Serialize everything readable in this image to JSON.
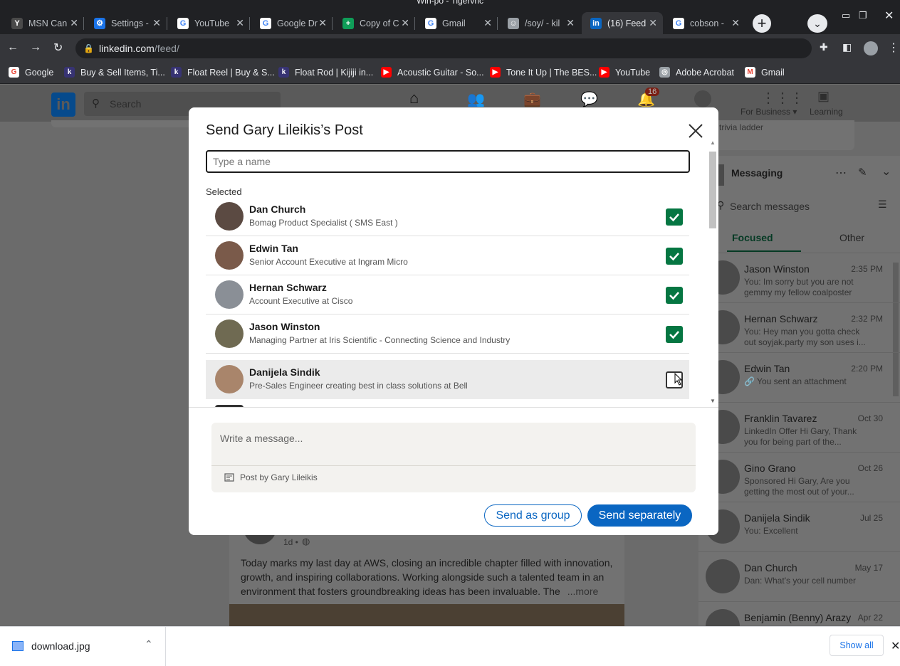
{
  "window": {
    "title": "Win-po - Tigervnc"
  },
  "tabs": [
    {
      "label": "MSN Can",
      "fav_color": "#4a4a4a",
      "fav_glyph": "Y"
    },
    {
      "label": "Settings -",
      "fav_color": "#1a73e8",
      "fav_glyph": "⚙"
    },
    {
      "label": "YouTube",
      "fav_color": "#ffffff",
      "fav_glyph": "G"
    },
    {
      "label": "Google Dr",
      "fav_color": "#ffffff",
      "fav_glyph": "G"
    },
    {
      "label": "Copy of C",
      "fav_color": "#0f9d58",
      "fav_glyph": "+"
    },
    {
      "label": "Gmail",
      "fav_color": "#ffffff",
      "fav_glyph": "G"
    },
    {
      "label": "/soy/ - kil",
      "fav_color": "#9aa0a6",
      "fav_glyph": "☺"
    },
    {
      "label": "(16) Feed",
      "fav_color": "#0a66c2",
      "fav_glyph": "in"
    },
    {
      "label": "cobson -",
      "fav_color": "#ffffff",
      "fav_glyph": "G"
    }
  ],
  "address": {
    "domain": "linkedin.com",
    "path": "/feed/"
  },
  "bookmarks": [
    {
      "label": "Google",
      "color": "#ffffff",
      "glyph": "G"
    },
    {
      "label": "Buy & Sell Items, Ti...",
      "color": "#373373",
      "glyph": "k"
    },
    {
      "label": "Float Reel | Buy & S...",
      "color": "#373373",
      "glyph": "k"
    },
    {
      "label": "Float Rod | Kijiji in...",
      "color": "#373373",
      "glyph": "k"
    },
    {
      "label": "Acoustic Guitar - So...",
      "color": "#ff0000",
      "glyph": "▶"
    },
    {
      "label": "Tone It Up | The BES...",
      "color": "#ff0000",
      "glyph": "▶"
    },
    {
      "label": "YouTube",
      "color": "#ff0000",
      "glyph": "▶"
    },
    {
      "label": "Adobe Acrobat",
      "color": "#9aa0a6",
      "glyph": "◎"
    },
    {
      "label": "Gmail",
      "color": "#ffffff",
      "glyph": "M"
    }
  ],
  "linkedin_nav": {
    "search_placeholder": "Search",
    "notif_count": "16",
    "for_business": "For Business ▾",
    "learning": "Learning",
    "trivia": "trivia ladder"
  },
  "modal": {
    "title": "Send Gary Lileikis’s Post",
    "name_placeholder": "Type a name",
    "selected_label": "Selected",
    "people": [
      {
        "name": "Dan Church",
        "title": "Bomag Product Specialist ( SMS East )",
        "checked": true,
        "avatar_color": "#5b4a42"
      },
      {
        "name": "Edwin Tan",
        "title": "Senior Account Executive at Ingram Micro",
        "checked": true,
        "avatar_color": "#7a5a4a"
      },
      {
        "name": "Hernan Schwarz",
        "title": "Account Executive at Cisco",
        "checked": true,
        "avatar_color": "#8a8f96"
      },
      {
        "name": "Jason Winston",
        "title": "Managing Partner at Iris Scientific - Connecting Science and Industry",
        "checked": true,
        "avatar_color": "#6f6a52"
      },
      {
        "name": "Danijela Sindik",
        "title": "Pre-Sales Engineer creating best in class solutions at Bell",
        "checked": false,
        "avatar_color": "#a9856b"
      }
    ],
    "message_placeholder": "Write a message...",
    "post_by": "Post by Gary Lileikis",
    "send_group": "Send as group",
    "send_separately": "Send separately"
  },
  "messaging": {
    "title": "Messaging",
    "search_placeholder": "Search messages",
    "tab_focused": "Focused",
    "tab_other": "Other",
    "threads": [
      {
        "name": "Jason Winston",
        "time": "2:35 PM",
        "preview": "You: Im sorry but you are not gemmy my fellow coalposter"
      },
      {
        "name": "Hernan Schwarz",
        "time": "2:32 PM",
        "preview": "You: Hey man you gotta check out soyjak.party my son uses i..."
      },
      {
        "name": "Edwin Tan",
        "time": "2:20 PM",
        "preview": "🔗 You sent an attachment"
      },
      {
        "name": "Franklin Tavarez",
        "time": "Oct 30",
        "preview": "LinkedIn Offer  Hi Gary, Thank you for being part of the..."
      },
      {
        "name": "Gino Grano",
        "time": "Oct 26",
        "preview": "Sponsored  Hi Gary, Are you getting the most out of your..."
      },
      {
        "name": "Danijela Sindik",
        "time": "Jul 25",
        "preview": "You: Excellent"
      },
      {
        "name": "Dan Church",
        "time": "May 17",
        "preview": "Dan: What's your cell number"
      },
      {
        "name": "Benjamin (Benny) Arazy",
        "time": "Apr 22",
        "preview": ""
      }
    ]
  },
  "feed_post": {
    "meta": "1d • ",
    "text": "Today marks my last day at AWS, closing an incredible chapter filled with innovation, growth, and inspiring collaborations. Working alongside such a talented team in an environment that fosters groundbreaking ideas has been invaluable. The",
    "more": "...more"
  },
  "download": {
    "filename": "download.jpg",
    "show_all": "Show all"
  }
}
